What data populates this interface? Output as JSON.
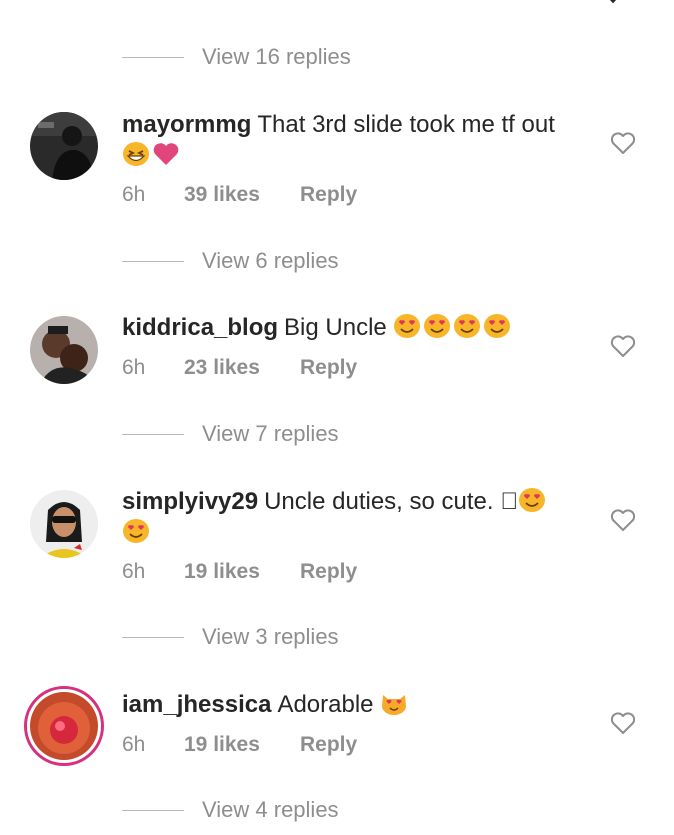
{
  "comments": [
    {
      "username": "mayormmg",
      "text": "That 3rd slide took me tf out",
      "time": "6h",
      "likes": "39 likes",
      "reply": "Reply",
      "view_replies": "View 6 replies"
    },
    {
      "username": "kiddrica_blog",
      "text": "Big Uncle",
      "time": "6h",
      "likes": "23 likes",
      "reply": "Reply",
      "view_replies": "View 7 replies"
    },
    {
      "username": "simplyivy29",
      "text": "Uncle duties, so cute. \u0000",
      "time": "6h",
      "likes": "19 likes",
      "reply": "Reply",
      "view_replies": "View 3 replies"
    },
    {
      "username": "iam_jhessica",
      "text": "Adorable",
      "time": "6h",
      "likes": "19 likes",
      "reply": "Reply",
      "view_replies": "View 4 replies"
    }
  ],
  "top_view_replies": "View 16 replies",
  "icons": {
    "like": "heart-outline-icon",
    "emoji_grin": "grinning-squinting-emoji",
    "emoji_heart": "pink-heart-emoji",
    "emoji_heart_eyes": "heart-eyes-emoji",
    "emoji_cat": "heart-eyes-cat-emoji"
  },
  "colors": {
    "text": "#262626",
    "muted": "#8e8e8e",
    "story_ring": "#d6317a",
    "emoji": "#f7b529",
    "heart": "#e0457b"
  }
}
